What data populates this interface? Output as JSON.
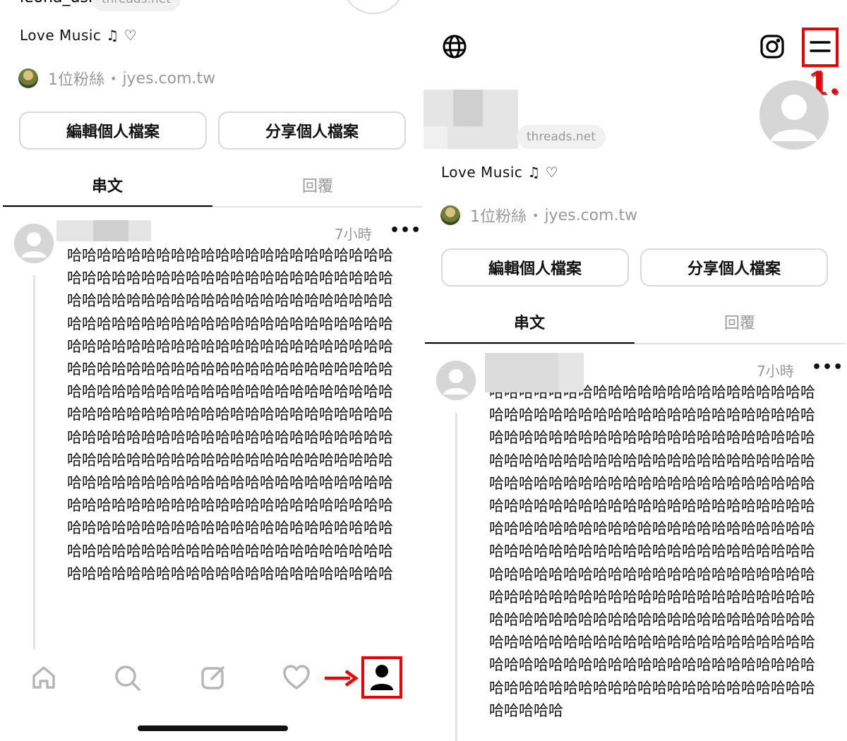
{
  "left": {
    "handle": "leona_usi",
    "domain_chip": "threads.net",
    "bio": "Love Music ♫ ♡",
    "followers": "1位粉絲",
    "separator": "•",
    "link": "jyes.com.tw",
    "edit_button": "編輯個人檔案",
    "share_button": "分享個人檔案",
    "tabs": [
      "串文",
      "回覆"
    ],
    "post": {
      "timestamp": "7小時",
      "more": "•••",
      "text": "哈哈哈哈哈哈哈哈哈哈哈哈哈哈哈哈哈哈哈哈哈哈哈哈哈哈哈哈哈哈哈哈哈哈哈哈哈哈哈哈哈哈哈哈哈哈哈哈哈哈哈哈哈哈哈哈哈哈哈哈哈哈哈哈哈哈哈哈哈哈哈哈哈哈哈哈哈哈哈哈哈哈哈哈哈哈哈哈哈哈哈哈哈哈哈哈哈哈哈哈哈哈哈哈哈哈哈哈哈哈哈哈哈哈哈哈哈哈哈哈哈哈哈哈哈哈哈哈哈哈哈哈哈哈哈哈哈哈哈哈哈哈哈哈哈哈哈哈哈哈哈哈哈哈哈哈哈哈哈哈哈哈哈哈哈哈哈哈哈哈哈哈哈哈哈哈哈哈哈哈哈哈哈哈哈哈哈哈哈哈哈哈哈哈哈哈哈哈哈哈哈哈哈哈哈哈哈哈哈哈哈哈哈哈哈哈哈哈哈哈哈哈哈哈哈哈哈哈哈哈哈哈哈哈哈哈哈哈哈哈哈哈哈哈哈哈哈哈哈哈哈哈哈哈哈哈哈哈哈哈哈哈哈哈哈哈哈哈哈哈哈哈哈哈哈哈哈哈哈哈哈哈哈哈哈哈哈哈哈哈哈哈哈哈哈哈哈哈哈哈哈哈哈哈哈哈哈哈哈哈哈哈哈哈哈哈哈哈哈哈哈哈哈哈哈哈哈哈哈哈"
    },
    "nav": {
      "items": [
        "home-icon",
        "search-icon",
        "compose-icon",
        "heart-icon",
        "profile-icon"
      ],
      "highlight_color": "#e00000",
      "arrow_color": "#e00000"
    }
  },
  "right": {
    "domain_chip": "threads.net",
    "bio": "Love Music ♫ ♡",
    "followers": "1位粉絲",
    "separator": "•",
    "link": "jyes.com.tw",
    "edit_button": "編輯個人檔案",
    "share_button": "分享個人檔案",
    "tabs": [
      "串文",
      "回覆"
    ],
    "step_label": "1.",
    "header_icons": [
      "globe-icon",
      "instagram-icon",
      "menu-icon"
    ],
    "post": {
      "timestamp": "7小時",
      "more": "•••",
      "text": "哈哈哈哈哈哈哈哈哈哈哈哈哈哈哈哈哈哈哈哈哈哈哈哈哈哈哈哈哈哈哈哈哈哈哈哈哈哈哈哈哈哈哈哈哈哈哈哈哈哈哈哈哈哈哈哈哈哈哈哈哈哈哈哈哈哈哈哈哈哈哈哈哈哈哈哈哈哈哈哈哈哈哈哈哈哈哈哈哈哈哈哈哈哈哈哈哈哈哈哈哈哈哈哈哈哈哈哈哈哈哈哈哈哈哈哈哈哈哈哈哈哈哈哈哈哈哈哈哈哈哈哈哈哈哈哈哈哈哈哈哈哈哈哈哈哈哈哈哈哈哈哈哈哈哈哈哈哈哈哈哈哈哈哈哈哈哈哈哈哈哈哈哈哈哈哈哈哈哈哈哈哈哈哈哈哈哈哈哈哈哈哈哈哈哈哈哈哈哈哈哈哈哈哈哈哈哈哈哈哈哈哈哈哈哈哈哈哈哈哈哈哈哈哈哈哈哈哈哈哈哈哈哈哈哈哈哈哈哈哈哈哈哈哈哈哈哈哈哈哈哈哈哈哈哈哈哈哈哈哈哈哈哈哈哈哈哈哈哈哈哈哈哈哈哈哈哈哈哈哈哈哈哈哈哈哈哈哈哈哈哈哈哈哈哈哈哈哈哈哈哈哈哈哈哈哈哈哈哈哈哈哈哈"
    },
    "highlight_color": "#e00000"
  }
}
